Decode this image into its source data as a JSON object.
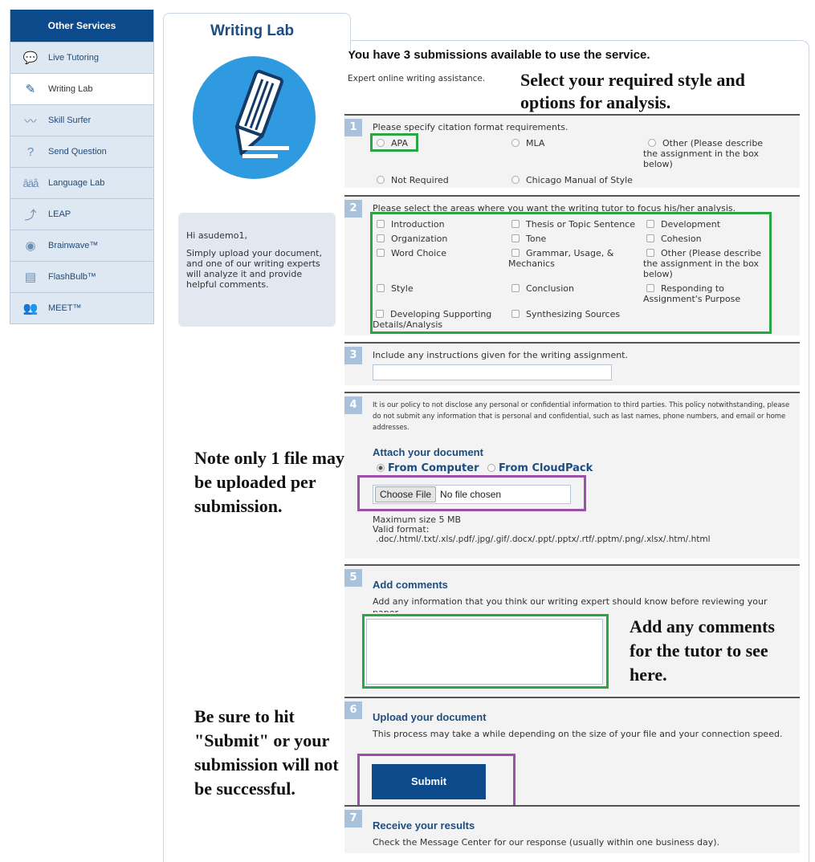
{
  "sidebar": {
    "header": "Other Services",
    "items": [
      {
        "label": "Live Tutoring",
        "icon": "chat-bubbles-icon"
      },
      {
        "label": "Writing Lab",
        "icon": "pen-icon",
        "active": true
      },
      {
        "label": "Skill Surfer",
        "icon": "wave-icon"
      },
      {
        "label": "Send Question",
        "icon": "question-icon"
      },
      {
        "label": "Language Lab",
        "icon": "letters-icon"
      },
      {
        "label": "LEAP",
        "icon": "leap-icon"
      },
      {
        "label": "Brainwave™",
        "icon": "brain-icon"
      },
      {
        "label": "FlashBulb™",
        "icon": "cards-icon"
      },
      {
        "label": "MEET™",
        "icon": "people-icon"
      }
    ]
  },
  "tab": {
    "title": "Writing Lab"
  },
  "greeting": {
    "hello": "Hi asudemo1,",
    "text": "Simply upload your document, and one of our writing experts will analyze it and provide helpful comments."
  },
  "availability": "You have 3 submissions available to use the service.",
  "expert_text": "Expert online writing assistance.",
  "annotations": {
    "style": "Select your required style and options for analysis.",
    "file": "Note only 1 file may be uploaded per submission.",
    "comments": "Add any comments for the tutor to see here.",
    "submit": "Be sure to hit \"Submit\" or your submission will not be successful."
  },
  "s1": {
    "num": "1",
    "question": "Please specify citation format requirements.",
    "options": [
      "APA",
      "MLA",
      "Other (Please describe the assignment in the box below)",
      "Not Required",
      "Chicago Manual of Style"
    ]
  },
  "s2": {
    "num": "2",
    "question": "Please select the areas where you want the writing tutor to focus his/her analysis.",
    "options": [
      "Introduction",
      "Thesis or Topic Sentence",
      "Development",
      "Organization",
      "Tone",
      "Cohesion",
      "Word Choice",
      "Grammar, Usage, & Mechanics",
      "Other (Please describe the assignment in the box below)",
      "Style",
      "Conclusion",
      "Responding to Assignment's Purpose",
      "Developing Supporting Details/Analysis",
      "Synthesizing Sources"
    ]
  },
  "s3": {
    "num": "3",
    "question": "Include any instructions given for the writing assignment."
  },
  "s4": {
    "num": "4",
    "policy": "It is our policy to not disclose any personal or confidential information to third parties. This policy notwithstanding, please do not submit any information that is personal and confidential, such as last names, phone numbers, and email or home addresses.",
    "attach": "Attach your document",
    "from_computer": "From Computer",
    "from_cloud": "From CloudPack",
    "choose_file": "Choose File",
    "no_file": "No file chosen",
    "max_size": "Maximum size 5 MB",
    "valid_label": "Valid format:",
    "formats": ".doc/.html/.txt/.xls/.pdf/.jpg/.gif/.docx/.ppt/.pptx/.rtf/.pptm/.png/.xlsx/.htm/.html"
  },
  "s5": {
    "num": "5",
    "title": "Add comments",
    "text": "Add any information that you think our writing expert should know before reviewing your paper."
  },
  "s6": {
    "num": "6",
    "title": "Upload your document",
    "text": "This process may take a while depending on the size of your file and your connection speed.",
    "submit": "Submit"
  },
  "s7": {
    "num": "7",
    "title": "Receive your results",
    "text": "Check the Message Center for our response (usually within one business day)."
  }
}
